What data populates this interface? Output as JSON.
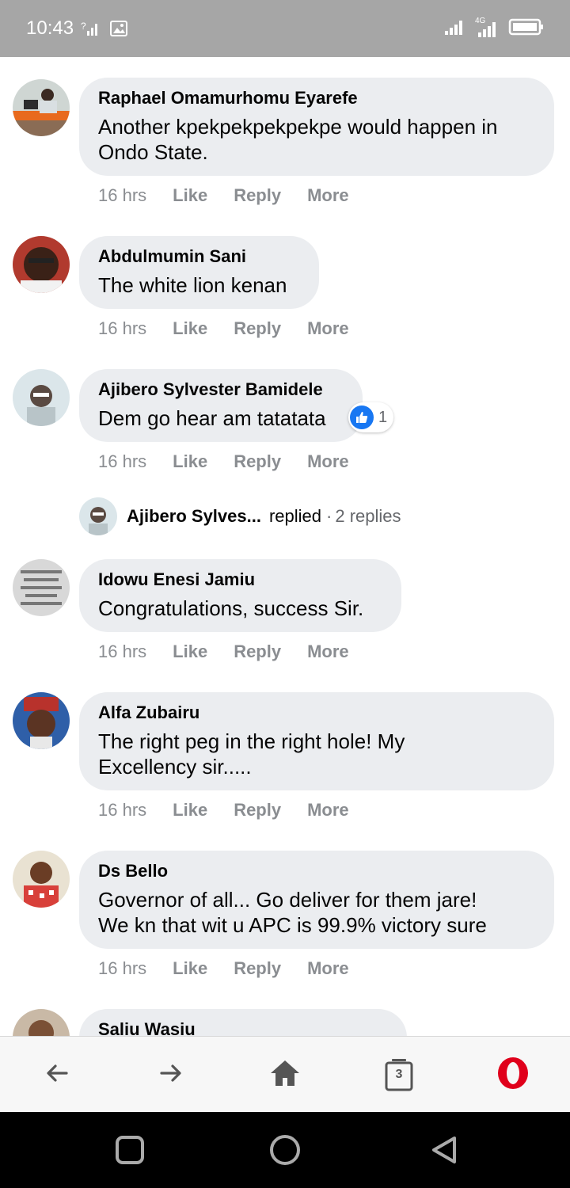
{
  "status_bar": {
    "time": "10:43",
    "network_label": "4G",
    "icons": [
      "signal-question-icon",
      "image-icon",
      "signal-icon",
      "network-4g-icon",
      "battery-icon"
    ]
  },
  "comments": [
    {
      "author": "Raphael Omamurhomu Eyarefe",
      "lines": [
        "Another kpekpekpekpekpe would happen in",
        "Ondo State."
      ],
      "time": "16 hrs",
      "like": "Like",
      "reply": "Reply",
      "more": "More"
    },
    {
      "author": "Abdulmumin Sani",
      "lines": [
        "The white lion kenan"
      ],
      "time": "16 hrs",
      "like": "Like",
      "reply": "Reply",
      "more": "More"
    },
    {
      "author": "Ajibero Sylvester Bamidele",
      "lines": [
        "Dem go hear am tatatata"
      ],
      "time": "16 hrs",
      "like": "Like",
      "reply": "Reply",
      "more": "More",
      "reaction_count": "1"
    },
    {
      "author": "Idowu Enesi Jamiu",
      "lines": [
        "Congratulations, success Sir."
      ],
      "time": "16 hrs",
      "like": "Like",
      "reply": "Reply",
      "more": "More"
    },
    {
      "author": "Alfa Zubairu",
      "lines": [
        "The right peg in the right hole! My",
        "Excellency sir....."
      ],
      "time": "16 hrs",
      "like": "Like",
      "reply": "Reply",
      "more": "More"
    },
    {
      "author": "Ds Bello",
      "lines": [
        "Governor of all... Go deliver for them jare!",
        "We kn that wit u APC is 99.9% victory sure"
      ],
      "time": "16 hrs",
      "like": "Like",
      "reply": "Reply",
      "more": "More"
    },
    {
      "author": "Saliu Wasiu",
      "lines": [],
      "time": "",
      "like": "",
      "reply": "",
      "more": ""
    }
  ],
  "replied_row": {
    "name": "Ajibero Sylves...",
    "action": "replied",
    "separator": "·",
    "count": "2 replies"
  },
  "browser_bar": {
    "tabs_count": "3",
    "items": [
      "back-icon",
      "forward-icon",
      "home-icon",
      "tabs-icon",
      "opera-logo-icon"
    ]
  },
  "nav_bar": {
    "items": [
      "recents-icon",
      "home-circle-icon",
      "back-triangle-icon"
    ]
  },
  "colors": {
    "bubble": "#ebedf0",
    "meta": "#8a8d91",
    "like_blue": "#1877f2",
    "opera_red": "#e0001b",
    "status_bg": "#a6a6a6"
  }
}
